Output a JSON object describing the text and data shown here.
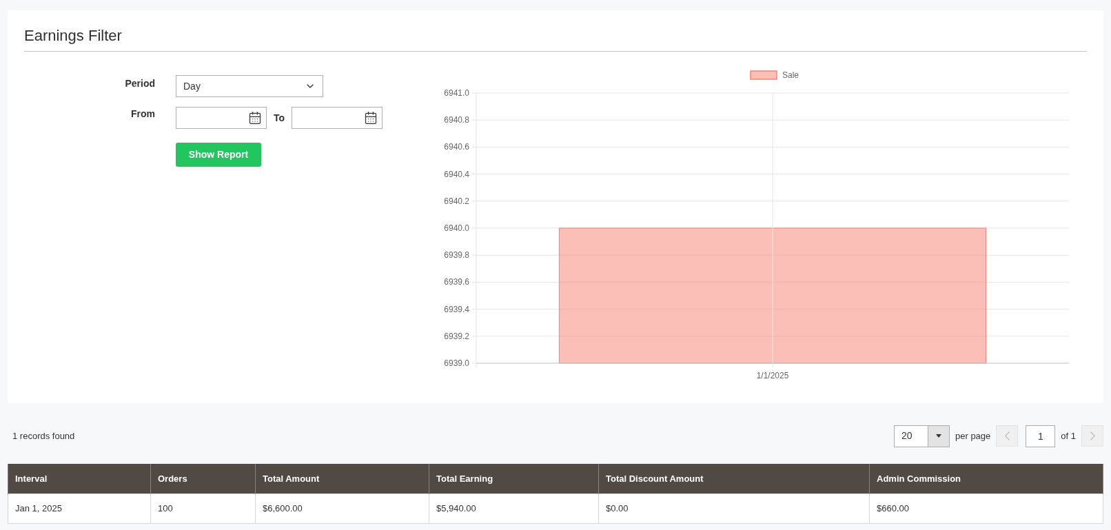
{
  "filter": {
    "title": "Earnings Filter",
    "period": {
      "label": "Period",
      "value": "Day"
    },
    "from": {
      "label": "From"
    },
    "to": {
      "label": "To"
    },
    "submit": "Show Report",
    "chart_data": {
      "type": "bar",
      "grid": true,
      "categories": [
        "1/1/2025"
      ],
      "series": [
        {
          "name": "Sale",
          "color": "#fa8072",
          "values": [
            6940
          ]
        }
      ],
      "ylim": [
        6939,
        6941
      ],
      "yticks": [
        {
          "value": 6939,
          "label": "6939.0"
        },
        {
          "value": 6939.2,
          "label": "6939.2"
        },
        {
          "value": 6939.4,
          "label": "6939.4"
        },
        {
          "value": 6939.6,
          "label": "6939.6"
        },
        {
          "value": 6939.8,
          "label": "6939.8"
        },
        {
          "value": 6940,
          "label": "6940.0"
        },
        {
          "value": 6940.2,
          "label": "6940.2"
        },
        {
          "value": 6940.4,
          "label": "6940.4"
        },
        {
          "value": 6940.6,
          "label": "6940.6"
        },
        {
          "value": 6940.8,
          "label": "6940.8"
        },
        {
          "value": 6941,
          "label": "6941.0"
        }
      ]
    }
  },
  "records": "1 records found",
  "pager": {
    "per_page_value": "20",
    "per_page_label": "per page",
    "page": "1",
    "of": "of 1",
    "prev_disabled": true,
    "next_disabled": true
  },
  "table": {
    "columns": [
      "Interval",
      "Orders",
      "Total Amount",
      "Total Earning",
      "Total Discount Amount",
      "Admin Commission"
    ],
    "rows": [
      [
        "Jan 1, 2025",
        "100",
        "$6,600.00",
        "$5,940.00",
        "$0.00",
        "$660.00"
      ]
    ]
  }
}
